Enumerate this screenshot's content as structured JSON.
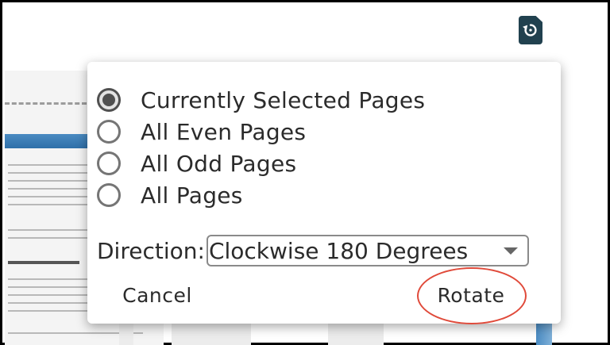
{
  "toolbar": {
    "rotate_icon": "rotate-document-icon"
  },
  "dialog": {
    "options": [
      {
        "label": "Currently Selected Pages",
        "checked": true
      },
      {
        "label": "All Even Pages",
        "checked": false
      },
      {
        "label": "All Odd Pages",
        "checked": false
      },
      {
        "label": "All Pages",
        "checked": false
      }
    ],
    "direction_label": "Direction:",
    "direction_value": "Clockwise 180 Degrees",
    "cancel_label": "Cancel",
    "rotate_label": "Rotate"
  },
  "colors": {
    "fab": "#21414f",
    "annotation_ring": "#e04a3a",
    "radio_border": "#757575"
  }
}
